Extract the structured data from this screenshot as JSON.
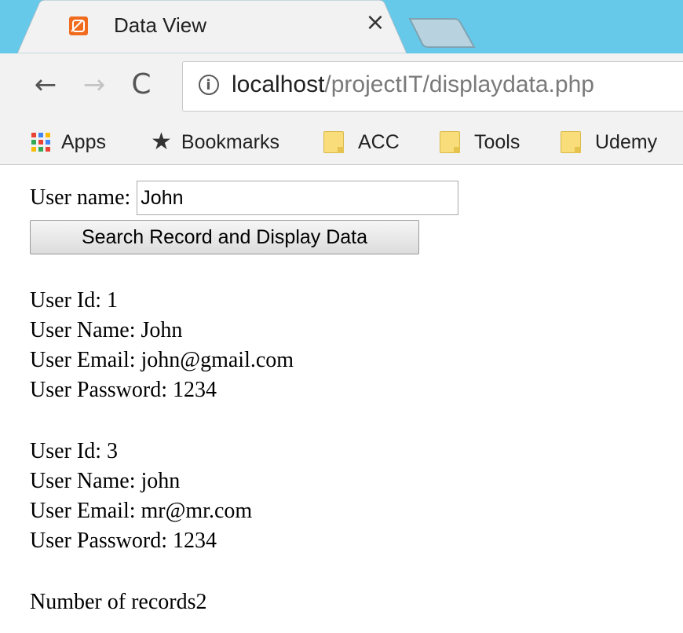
{
  "browser": {
    "tab": {
      "title": "Data View",
      "close_glyph": "×",
      "favicon": "xampp-icon"
    },
    "url": {
      "host": "localhost",
      "path": "/projectIT/displaydata.php"
    },
    "nav": {
      "back": "←",
      "forward": "→",
      "reload": "C"
    },
    "bookmarks": [
      {
        "label": "Apps",
        "icon": "apps-grid-icon"
      },
      {
        "label": "Bookmarks",
        "icon": "star-icon"
      },
      {
        "label": "ACC",
        "icon": "folder-icon"
      },
      {
        "label": "Tools",
        "icon": "folder-icon"
      },
      {
        "label": "Udemy",
        "icon": "folder-icon"
      }
    ],
    "colors": {
      "tabstrip": "#67c9ea",
      "toolbar": "#f2f2f2",
      "favicon": "#f06b1e"
    }
  },
  "form": {
    "label": "User name:",
    "input_value": "John",
    "button_label": "Search Record and Display Data"
  },
  "records": [
    {
      "id_line": "User Id: 1",
      "name_line": "User Name: John",
      "email_line": "User Email: john@gmail.com",
      "password_line": "User Password: 1234"
    },
    {
      "id_line": "User Id: 3",
      "name_line": "User Name: john",
      "email_line": "User Email: mr@mr.com",
      "password_line": "User Password: 1234"
    }
  ],
  "summary": {
    "count_line": "Number of records2"
  }
}
